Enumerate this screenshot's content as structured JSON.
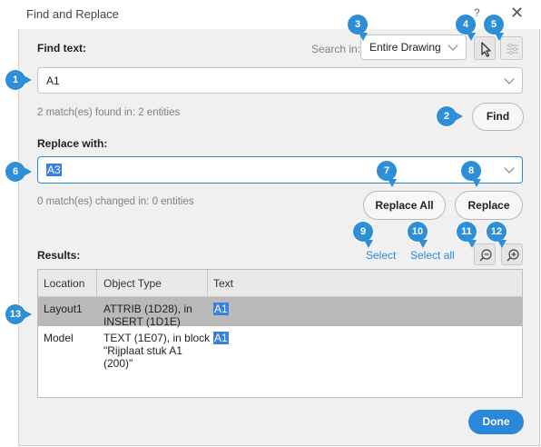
{
  "dialog": {
    "title": "Find and Replace",
    "help_label": "?",
    "close_label": "✕"
  },
  "find": {
    "label": "Find text:",
    "value": "A1",
    "status": "2 match(es) found in: 2 entities",
    "button": "Find"
  },
  "search_in": {
    "label": "Search in:",
    "value": "Entire Drawing"
  },
  "replace": {
    "label": "Replace with:",
    "value": "A3",
    "status": "0 match(es) changed in: 0 entities",
    "replace_all_button": "Replace All",
    "replace_button": "Replace"
  },
  "results": {
    "label": "Results:",
    "select_link": "Select",
    "select_all_link": "Select all",
    "columns": [
      "Location",
      "Object Type",
      "Text"
    ],
    "rows": [
      {
        "location": "Layout1",
        "object_type": [
          "ATTRIB (1D28), in",
          "INSERT (1D1E)"
        ],
        "text": "A1",
        "selected": true
      },
      {
        "location": "Model",
        "object_type": [
          "TEXT (1E07), in block",
          "\"Rijplaat stuk A1",
          "(200)\""
        ],
        "text": "A1",
        "selected": false
      }
    ]
  },
  "done_button": "Done",
  "callouts": [
    "1",
    "2",
    "3",
    "4",
    "5",
    "6",
    "7",
    "8",
    "9",
    "10",
    "11",
    "12",
    "13"
  ],
  "icons": {
    "pick": "cursor-arrow-icon",
    "filter": "filter-icon",
    "zoom_out": "zoom-out-icon",
    "zoom_in": "zoom-in-icon"
  },
  "colors": {
    "accent": "#2b88d8",
    "callout": "#2e8fd6",
    "selection": "#b9b9b9",
    "text_highlight": "#3b7fe0"
  }
}
